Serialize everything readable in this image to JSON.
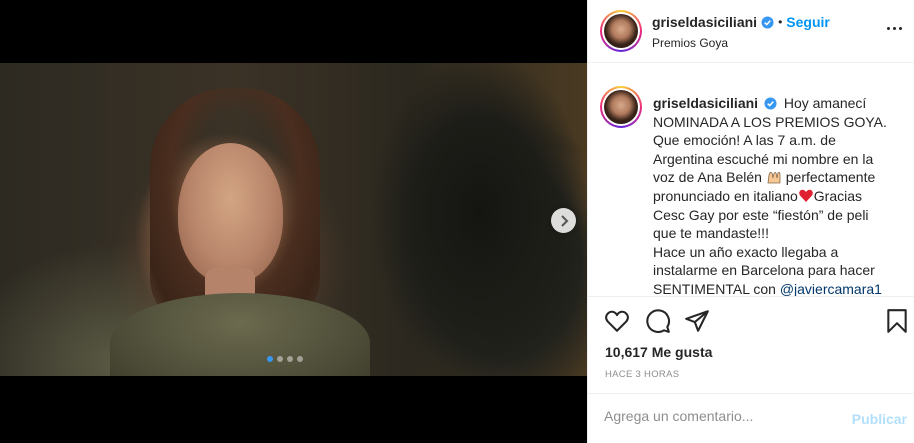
{
  "post": {
    "username": "griseldasiciliani",
    "follow_label": "Seguir",
    "separator": "•",
    "location": "Premios Goya",
    "caption": {
      "line1": "Hoy amanecí",
      "line2": "NOMINADA A LOS PREMIOS GOYA.",
      "line3": "Que emoción! A las 7 a.m. de",
      "line4": "Argentina escuché mi nombre en la",
      "line5_pre": "voz de Ana Belén",
      "line5_post": "perfectamente",
      "line6_pre": "pronunciado en italiano",
      "line6_post": "Gracias",
      "line7": "Cesc Gay por este “fiestón” de peli",
      "line8": "que te mandaste!!!",
      "line9": "Hace un año exacto llegaba a",
      "line10": "instalarme en Barcelona para hacer",
      "line11_pre": "SENTIMENTAL con",
      "mention": "@javiercamara1"
    },
    "likes": "10,617 Me gusta",
    "timestamp": "HACE 3 HORAS",
    "comment": {
      "placeholder": "Agrega un comentario...",
      "publish_label": "Publicar"
    },
    "carousel": {
      "total": 4,
      "active_index": 0
    }
  },
  "icons": {
    "verified": "verified-badge-icon",
    "more": "more-options-icon",
    "like": "heart-icon",
    "comment": "comment-icon",
    "share": "paper-plane-icon",
    "save": "bookmark-icon",
    "next": "chevron-right-icon",
    "emoji1": "raising-hands-emoji",
    "emoji2": "red-heart-emoji"
  },
  "colors": {
    "accent": "#0095f6",
    "mention": "#00376b",
    "muted": "#8e8e8e",
    "publish_disabled": "#b2dffc",
    "carousel_active": "#3897f0"
  }
}
